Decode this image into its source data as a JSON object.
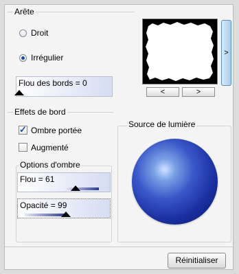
{
  "edge": {
    "legend": "Arête",
    "radio_straight": "Droit",
    "radio_irregular": "Irrégulier",
    "selected": "Irrégulier",
    "blur_label": "Flou des bords = 0",
    "blur_value": 0,
    "nav_prev": "<",
    "nav_next": ">",
    "side_arrow": ">"
  },
  "effects": {
    "legend": "Effets de bord",
    "drop_shadow_label": "Ombre portée",
    "drop_shadow_checked": true,
    "enhanced_label": "Augmenté",
    "enhanced_checked": false,
    "shadow_options": {
      "legend": "Options d'ombre",
      "blur_label": "Flou = 61",
      "blur_value": 61,
      "opacity_label": "Opacité = 99",
      "opacity_value": 99
    }
  },
  "light": {
    "legend": "Source de lumière",
    "sphere_color": "#1a2fa0",
    "highlight_color": "#cfe4ff"
  },
  "reset_label": "Réinitialiser",
  "colors": {
    "accent": "#1f4f9c",
    "panel_bg": "#f4f4f4",
    "slider_dark": "#2c3b8f"
  }
}
